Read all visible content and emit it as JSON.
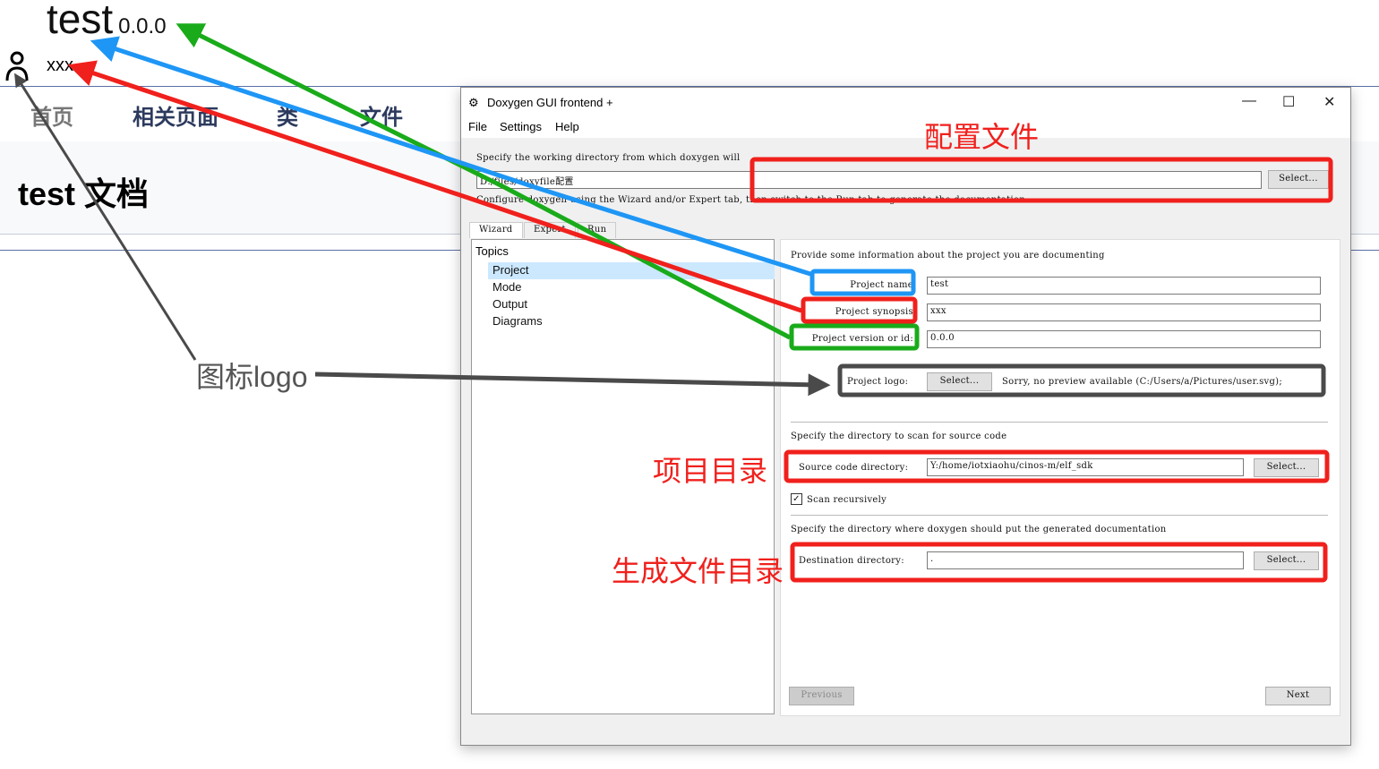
{
  "website": {
    "project_name": "test",
    "project_version": "0.0.0",
    "project_synopsis": "xxx",
    "nav": [
      "首页",
      "相关页面",
      "类",
      "文件"
    ],
    "page_title": "test 文档"
  },
  "window": {
    "title": "Doxygen GUI frontend +",
    "menu": [
      "File",
      "Settings",
      "Help"
    ],
    "controls": {
      "minimize": "—",
      "maximize": "☐",
      "close": "✕"
    },
    "workdir_label": "Specify the working directory from which doxygen will",
    "workdir_value": "D:/files/doxyfile配置",
    "select": "Select...",
    "configure_hint": "Configure doxygen using the Wizard and/or Expert tab, then switch to the Run tab to generate the documentation",
    "tabs": [
      "Wizard",
      "Expert",
      "Run"
    ],
    "topics_label": "Topics",
    "topics": [
      "Project",
      "Mode",
      "Output",
      "Diagrams"
    ],
    "project": {
      "intro": "Provide some information about the project you are documenting",
      "name_label": "Project name",
      "name_value": "test",
      "synopsis_label": "Project synopsis",
      "synopsis_value": "xxx",
      "version_label": "Project version or id:",
      "version_value": "0.0.0",
      "logo_label": "Project logo:",
      "logo_status": "Sorry, no preview available (C:/Users/a/Pictures/user.svg);",
      "source_intro": "Specify the directory to scan for source code",
      "source_label": "Source code directory:",
      "source_value": "Y:/home/iotxiaohu/cinos-m/elf_sdk",
      "scan_recursive": "Scan recursively",
      "dest_intro": "Specify the directory where doxygen should put the generated documentation",
      "dest_label": "Destination directory:",
      "dest_value": "."
    },
    "previous": "Previous",
    "next": "Next"
  },
  "annotations": {
    "config_file": "配置文件",
    "logo": "图标logo",
    "project_dir": "项目目录",
    "output_dir": "生成文件目录"
  },
  "colors": {
    "red": "#f0201c",
    "blue": "#1e96f5",
    "green": "#1aab1a",
    "gray": "#4a4a4a"
  }
}
